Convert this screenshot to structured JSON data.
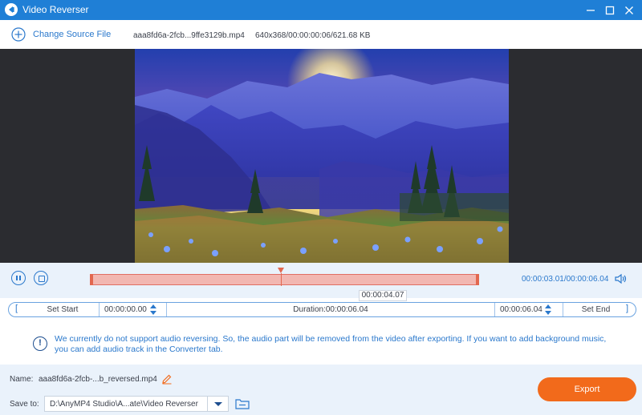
{
  "window": {
    "title": "Video Reverser",
    "icon": "app-logo-icon",
    "controls": [
      "minimize-icon",
      "maximize-icon",
      "close-icon"
    ]
  },
  "source": {
    "change_label": "Change Source File",
    "file_name": "aaa8fd6a-2fcb...9ffe3129b.mp4",
    "file_meta": "640x368/00:00:00:06/621.68 KB"
  },
  "player": {
    "current_time": "00:00:03.01",
    "total_time": "00:00:06.04",
    "time_readout": "00:00:03.01/00:00:06.04",
    "progress_fraction": 0.49,
    "tooltip_time": "00:00:04.07"
  },
  "trim": {
    "set_start_label": "Set Start",
    "start_time": "00:00:00.00",
    "duration": "Duration:00:00:06.04",
    "end_time": "00:00:06.04",
    "set_end_label": "Set End"
  },
  "notice": {
    "icon": "info-icon",
    "text": "We currently do not support audio reversing. So, the audio part will be removed from the video after exporting. If you want to add background music, you can add audio track in the Converter tab."
  },
  "output": {
    "name_label": "Name:",
    "name_value": "aaa8fd6a-2fcb-...b_reversed.mp4",
    "save_label": "Save to:",
    "save_path": "D:\\AnyMP4 Studio\\A...ate\\Video Reverser",
    "export_label": "Export"
  },
  "colors": {
    "accent": "#1f7fd6",
    "link": "#2a78cc",
    "export": "#f26a1b",
    "trim_track": "#f2b7b1",
    "playhead": "#e2674f"
  }
}
